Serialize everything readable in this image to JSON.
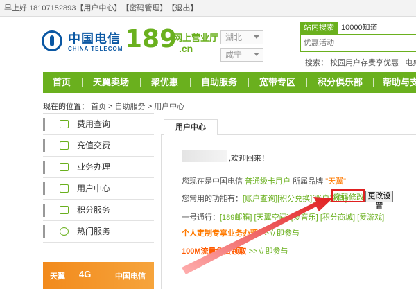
{
  "topbar": {
    "greeting": "早上好,18107152893",
    "links": [
      "【用户中心】",
      "【密码管理】",
      "【退出】"
    ]
  },
  "header": {
    "brand_cn": "中国电信",
    "brand_en": "CHINA TELECOM",
    "brand_189": "189",
    "brand_hall": "网上营业厅",
    "brand_suffix": ".cn",
    "province": "湖北",
    "city": "咸宁",
    "search_tabs": [
      "站内搜索",
      "10000知道"
    ],
    "search_placeholder": "优惠活动",
    "hot_label": "搜索：",
    "hot_items": [
      "校园用户存费享优惠",
      "电桌#"
    ]
  },
  "nav": {
    "items": [
      "首页",
      "天翼卖场",
      "聚优惠",
      "自助服务",
      "宽带专区",
      "积分俱乐部",
      "帮助与支"
    ]
  },
  "breadcrumb": {
    "prefix": "现在的位置：",
    "items": [
      "首页",
      "自助服务",
      "用户中心"
    ],
    "sep": ">"
  },
  "sidebar": {
    "items": [
      "费用查询",
      "充值交费",
      "业务办理",
      "用户中心",
      "积分服务",
      "热门服务"
    ]
  },
  "banner": {
    "items": [
      "天翼",
      "4G",
      "中国电信"
    ]
  },
  "main": {
    "tab": "用户中心",
    "welcome": ",欢迎回来！",
    "status_prefix": "您现在是中国电信",
    "user_type": "普通级卡用户",
    "brand_label": "所属品牌",
    "brand_value": "\"天翼\"",
    "functions_label": "您常用的功能有：",
    "functions": [
      "[账户查询]",
      "[积分兑换]",
      "[账户充值]"
    ],
    "pwd_link": "密码修改",
    "pwd_button": "更改设置",
    "onepass_label": "一号通行：",
    "onepass_links": [
      "[189邮箱]",
      "[天翼空间]",
      "[爱音乐]",
      "[积分商城]",
      "[爱游戏]"
    ],
    "promo1_title": "个人定制专享业务办理",
    "promo1_go": ">>立即参与",
    "promo2_title": "100M流量免费领取",
    "promo2_go": ">>立即参与"
  },
  "colors": {
    "brand_green": "#6ab01e",
    "telecom_blue": "#0a57a3",
    "highlight_red": "#e02020",
    "promo_orange": "#ff7a00"
  }
}
